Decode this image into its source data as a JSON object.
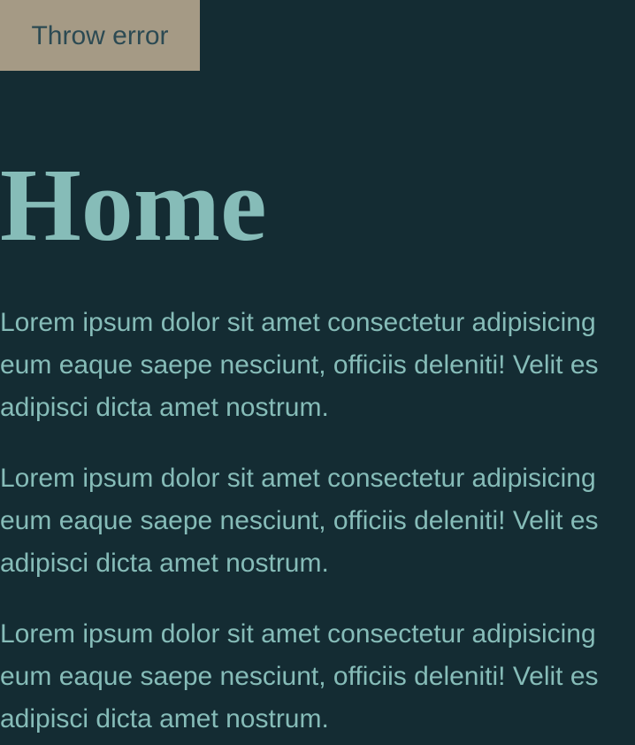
{
  "toolbar": {
    "throw_error_label": "Throw error"
  },
  "main": {
    "title": "Home",
    "paragraphs": [
      {
        "lines": [
          "Lorem ipsum dolor sit amet consectetur adipisicing",
          "eum eaque saepe nesciunt, officiis deleniti! Velit es",
          "adipisci dicta amet nostrum."
        ]
      },
      {
        "lines": [
          "Lorem ipsum dolor sit amet consectetur adipisicing",
          "eum eaque saepe nesciunt, officiis deleniti! Velit es",
          "adipisci dicta amet nostrum."
        ]
      },
      {
        "lines": [
          "Lorem ipsum dolor sit amet consectetur adipisicing",
          "eum eaque saepe nesciunt, officiis deleniti! Velit es",
          "adipisci dicta amet nostrum."
        ]
      }
    ]
  },
  "colors": {
    "background": "#142c33",
    "button_bg": "#a59a85",
    "button_text": "#2c4a53",
    "text": "#86bcb8"
  }
}
